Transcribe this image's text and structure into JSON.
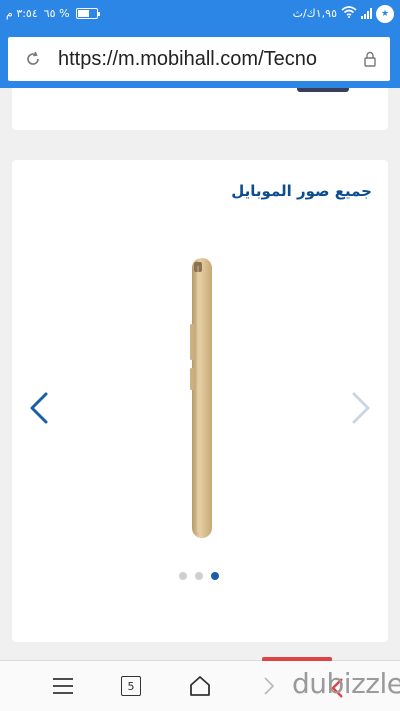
{
  "status_bar": {
    "time": "٣:٥٤ م",
    "battery_percent_label": "٦٥ %",
    "battery_level": 0.65,
    "network_speed": "١,٩٥ك/ث",
    "notification_badge": "★"
  },
  "url_bar": {
    "url": "https://m.mobihall.com/Tecno",
    "reload_icon": "reload-icon",
    "lock_icon": "lock-icon"
  },
  "gallery": {
    "title": "جميع صور الموبايل",
    "dots_count": 3,
    "active_dot_index": 2,
    "colors": {
      "arrow_active": "#1a5ea8",
      "arrow_inactive": "#c9d6e6",
      "phone_gold": "#d9bd8f"
    }
  },
  "bottom_toolbar": {
    "menu_icon": "menu-icon",
    "tabs_count": "5",
    "home_icon": "home-icon",
    "forward_icon": "chevron-right-icon"
  },
  "watermark": {
    "text": "dubizzle"
  },
  "colors": {
    "chrome_blue": "#2b86e5",
    "title_blue": "#0b4d8f"
  }
}
